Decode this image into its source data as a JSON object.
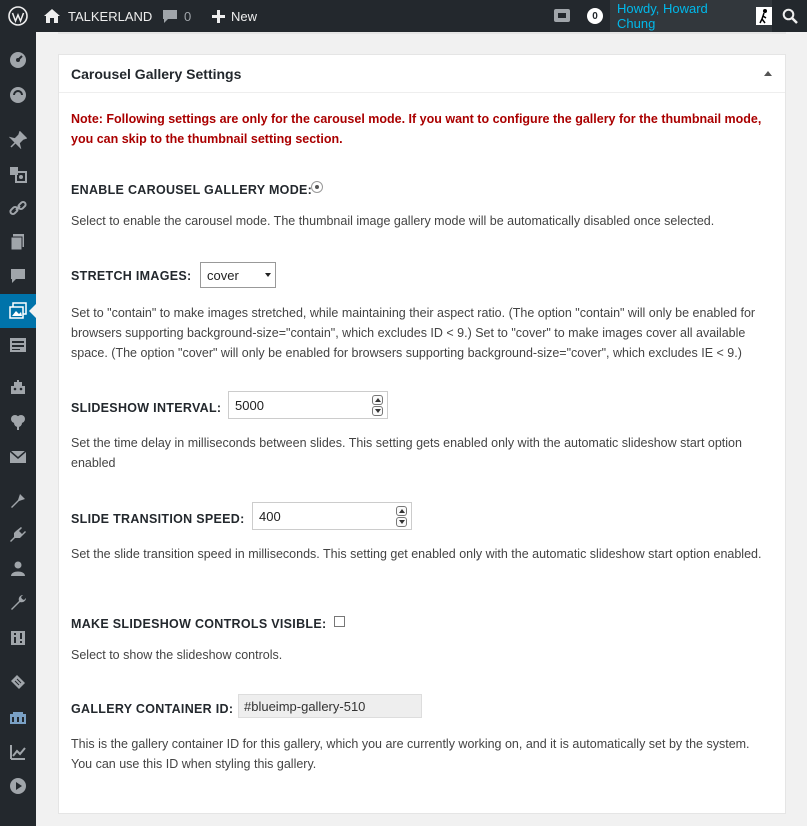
{
  "adminbar": {
    "site_name": "TALKERLAND",
    "comments_count": "0",
    "new_label": "New",
    "notifications_count": "0",
    "howdy": "Howdy, Howard Chung"
  },
  "sidebar": {
    "icons": [
      "dashboard-icon",
      "updates-icon",
      "posts-icon",
      "media-icon",
      "links-icon",
      "pages-icon",
      "comments-icon",
      "gallery-icon",
      "forms-icon",
      "plugin-icon",
      "feedback-icon",
      "mail-icon",
      "appearance-icon",
      "plugins-icon",
      "users-icon",
      "tools-icon",
      "settings-icon",
      "tag-icon",
      "slider-icon",
      "analytics-icon",
      "play-icon"
    ],
    "active_index": 7
  },
  "panel": {
    "title": "Carousel Gallery Settings",
    "note": "Note: Following settings are only for the carousel mode. If you want to configure the gallery for the thumbnail mode, you can skip to the thumbnail setting section.",
    "enable_label": "ENABLE CAROUSEL GALLERY MODE:",
    "enable_desc": "Select to enable the carousel mode. The thumbnail image gallery mode will be automatically disabled once selected.",
    "stretch_label": "STRETCH IMAGES:",
    "stretch_value": "cover",
    "stretch_desc": "Set to \"contain\" to make images stretched, while maintaining their aspect ratio. (The option \"contain\" will only be enabled for browsers supporting background-size=\"contain\", which excludes ID < 9.) Set to \"cover\" to make images cover all available space. (The option \"cover\" will only be enabled for browsers supporting background-size=\"cover\", which excludes IE < 9.)",
    "interval_label": "SLIDESHOW INTERVAL:",
    "interval_value": "5000",
    "interval_desc": "Set the time delay in milliseconds between slides. This setting gets enabled only with the automatic slideshow start option enabled",
    "speed_label": "SLIDE TRANSITION SPEED:",
    "speed_value": "400",
    "speed_desc": "Set the slide transition speed in milliseconds. This setting get enabled only with the automatic slideshow start option enabled.",
    "controls_label": "MAKE SLIDESHOW CONTROLS VISIBLE:",
    "controls_desc": "Select to show the slideshow controls.",
    "container_label": "GALLERY CONTAINER ID:",
    "container_value": "#blueimp-gallery-510",
    "container_desc": "This is the gallery container ID for this gallery, which you are currently working on, and it is automatically set by the system. You can use this ID when styling this gallery."
  }
}
